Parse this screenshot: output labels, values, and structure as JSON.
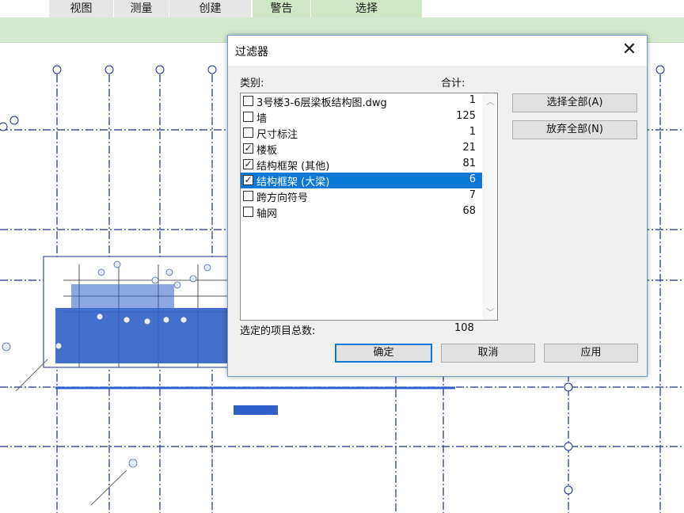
{
  "ribbon": {
    "tabs": [
      {
        "label": "视图"
      },
      {
        "label": "测量"
      },
      {
        "label": "创建"
      },
      {
        "label": "警告"
      },
      {
        "label": "选择"
      }
    ]
  },
  "dialog": {
    "title": "过滤器",
    "category_header": "类别:",
    "total_header": "合计:",
    "items": [
      {
        "name": "3号楼3-6层梁板结构图.dwg",
        "count": "1",
        "checked": false,
        "selected": false
      },
      {
        "name": "墙",
        "count": "125",
        "checked": false,
        "selected": false
      },
      {
        "name": "尺寸标注",
        "count": "1",
        "checked": false,
        "selected": false
      },
      {
        "name": "楼板",
        "count": "21",
        "checked": true,
        "selected": false
      },
      {
        "name": "结构框架 (其他)",
        "count": "81",
        "checked": true,
        "selected": false
      },
      {
        "name": "结构框架 (大梁)",
        "count": "6",
        "checked": true,
        "selected": true
      },
      {
        "name": "跨方向符号",
        "count": "7",
        "checked": false,
        "selected": false
      },
      {
        "name": "轴网",
        "count": "68",
        "checked": false,
        "selected": false
      }
    ],
    "select_all_label": "选择全部(A)",
    "deselect_all_label": "放弃全部(N)",
    "total_selected_label": "选定的项目总数:",
    "total_selected_value": "108",
    "ok_label": "确定",
    "cancel_label": "取消",
    "apply_label": "应用"
  },
  "icons": {
    "checkbox_checked": "check-icon",
    "close": "close-icon"
  },
  "colors": {
    "selection_blue": "#0a78d7",
    "ribbon_green": "#d3ead0",
    "drawing_blue": "#2f5fc8"
  }
}
